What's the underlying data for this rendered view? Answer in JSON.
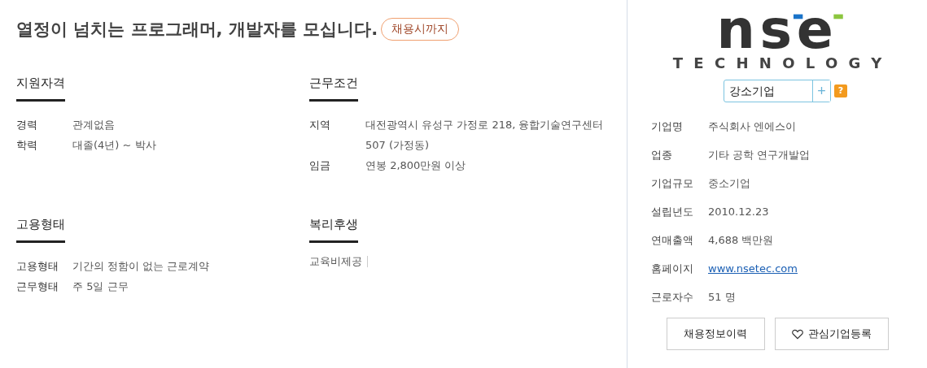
{
  "title": "열정이 넘치는 프로그래머, 개발자를 모십니다.",
  "deadline_badge": "채용시까지",
  "sections": [
    {
      "heading": "지원자격",
      "kind": "fields",
      "rows": [
        {
          "label": "경력",
          "value": "관계없음"
        },
        {
          "label": "학력",
          "value": "대졸(4년) ~ 박사"
        }
      ]
    },
    {
      "heading": "근무조건",
      "kind": "fields",
      "rows": [
        {
          "label": "지역",
          "value": "대전광역시 유성구 가정로 218, 융합기술연구센터 507 (가정동)"
        },
        {
          "label": "임금",
          "value": "연봉 2,800만원 이상"
        }
      ]
    },
    {
      "heading": "고용형태",
      "kind": "fields",
      "rows": [
        {
          "label": "고용형태",
          "value": "기간의 정함이 없는 근로계약"
        },
        {
          "label": "근무형태",
          "value": "주 5일 근무"
        }
      ]
    },
    {
      "heading": "복리후생",
      "kind": "tags",
      "tags": [
        "교육비제공"
      ]
    }
  ],
  "company": {
    "logo": {
      "mark": "nse",
      "tagline": "TECHNOLOGY"
    },
    "tag": {
      "label": "강소기업",
      "button": "+",
      "help": "?"
    },
    "info": [
      {
        "label": "기업명",
        "value": "주식회사 엔에스이",
        "kind": "text"
      },
      {
        "label": "업종",
        "value": "기타 공학 연구개발업",
        "kind": "text"
      },
      {
        "label": "기업규모",
        "value": "중소기업",
        "kind": "text"
      },
      {
        "label": "설립년도",
        "value": "2010.12.23",
        "kind": "text"
      },
      {
        "label": "연매출액",
        "value": "4,688 백만원",
        "kind": "text"
      },
      {
        "label": "홈페이지",
        "value": "www.nsetec.com",
        "kind": "link"
      },
      {
        "label": "근로자수",
        "value": "51 명",
        "kind": "text"
      }
    ],
    "buttons": [
      {
        "label": "채용정보이력",
        "kind": "plain"
      },
      {
        "label": "관심기업등록",
        "kind": "favorite"
      }
    ]
  }
}
